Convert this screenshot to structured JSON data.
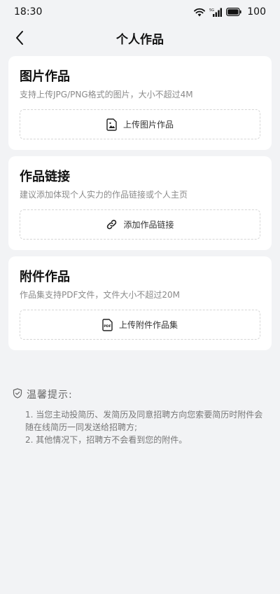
{
  "status": {
    "time": "18:30",
    "battery": "100",
    "network_badge": "5G"
  },
  "nav": {
    "title": "个人作品"
  },
  "cards": [
    {
      "title": "图片作品",
      "desc": "支持上传JPG/PNG格式的图片，大小不超过4M",
      "action": "上传图片作品",
      "icon": "image-icon"
    },
    {
      "title": "作品链接",
      "desc": "建议添加体现个人实力的作品链接或个人主页",
      "action": "添加作品链接",
      "icon": "link-icon"
    },
    {
      "title": "附件作品",
      "desc": "作品集支持PDF文件，文件大小不超过20M",
      "action": "上传附件作品集",
      "icon": "pdf-icon",
      "icon_text": "PDF"
    }
  ],
  "tips": {
    "title": "温馨提示:",
    "items": [
      "1. 当您主动投简历、发简历及同意招聘方向您索要简历时附件会随在线简历一同发送给招聘方;",
      "2. 其他情况下，招聘方不会看到您的附件。"
    ]
  }
}
